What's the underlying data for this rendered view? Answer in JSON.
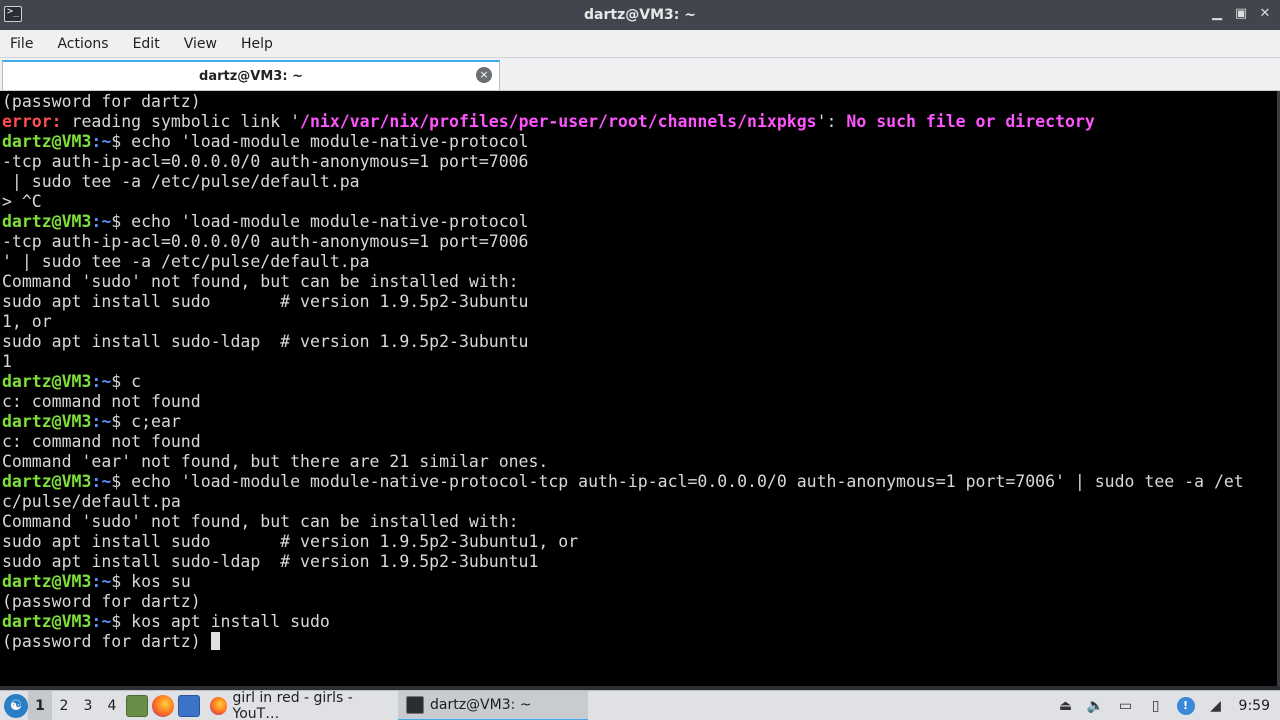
{
  "window": {
    "title": "dartz@VM3: ~",
    "controls": {
      "minimize": "▁",
      "restore": "▣",
      "close": "✕"
    }
  },
  "menu": [
    "File",
    "Actions",
    "Edit",
    "View",
    "Help"
  ],
  "tab": {
    "label": "dartz@VM3: ~",
    "close": "×"
  },
  "terminal": {
    "prompt_user": "dartz@VM3",
    "prompt_path": ":~",
    "prompt_sym": "$ ",
    "lines": {
      "l1": "(password for dartz)",
      "l2_err": "error:",
      "l2_a": " reading symbolic link '",
      "l2_path": "/nix/var/nix/profiles/per-user/root/channels/nixpkgs",
      "l2_b": "': ",
      "l2_msg": "No such file or directory",
      "l3_cmd": "echo 'load-module module-native-protocol",
      "l4": "-tcp auth-ip-acl=0.0.0.0/0 auth-anonymous=1 port=7006",
      "l5": " | sudo tee -a /etc/pulse/default.pa",
      "l6": "> ^C",
      "l7_cmd": "echo 'load-module module-native-protocol",
      "l8": "-tcp auth-ip-acl=0.0.0.0/0 auth-anonymous=1 port=7006",
      "l9": "' | sudo tee -a /etc/pulse/default.pa",
      "l10": "Command 'sudo' not found, but can be installed with:",
      "l11": "sudo apt install sudo       # version 1.9.5p2-3ubuntu",
      "l12": "1, or",
      "l13": "sudo apt install sudo-ldap  # version 1.9.5p2-3ubuntu",
      "l14": "1",
      "l15_cmd": "c",
      "l16": "c: command not found",
      "l17_cmd": "c;ear",
      "l18": "c: command not found",
      "l19": "Command 'ear' not found, but there are 21 similar ones.",
      "l20_cmd": "echo 'load-module module-native-protocol-tcp auth-ip-acl=0.0.0.0/0 auth-anonymous=1 port=7006' | sudo tee -a /et",
      "l21": "c/pulse/default.pa",
      "l22": "Command 'sudo' not found, but can be installed with:",
      "l23": "sudo apt install sudo       # version 1.9.5p2-3ubuntu1, or",
      "l24": "sudo apt install sudo-ldap  # version 1.9.5p2-3ubuntu1",
      "l25_cmd": "kos su",
      "l26": "(password for dartz)",
      "l27_cmd": "kos apt install sudo",
      "l28": "(password for dartz) "
    }
  },
  "taskbar": {
    "desktops": [
      "1",
      "2",
      "3",
      "4"
    ],
    "tasks": {
      "youtube": "girl in red - girls - YouT…",
      "terminal": "dartz@VM3: ~"
    },
    "clock": "9:59"
  },
  "colors": {
    "prompt": "#7ee03a",
    "path": "#5b8cff",
    "error": "#ff4d4d",
    "highlight": "#ff55ff",
    "accent": "#3daee9"
  }
}
